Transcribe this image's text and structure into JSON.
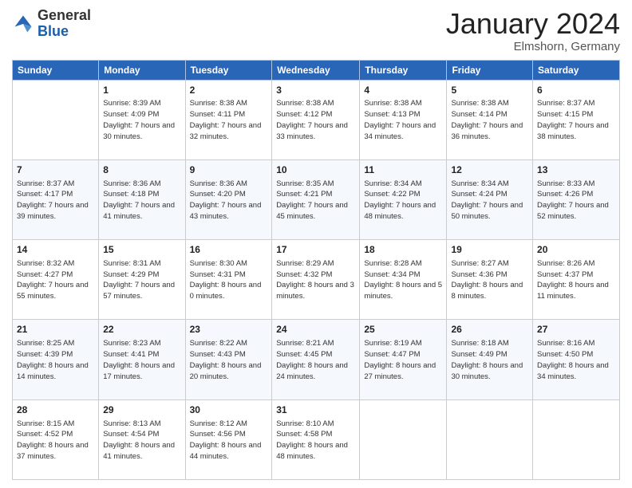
{
  "header": {
    "logo_general": "General",
    "logo_blue": "Blue",
    "month_title": "January 2024",
    "location": "Elmshorn, Germany"
  },
  "weekdays": [
    "Sunday",
    "Monday",
    "Tuesday",
    "Wednesday",
    "Thursday",
    "Friday",
    "Saturday"
  ],
  "weeks": [
    [
      {
        "day": "",
        "info": ""
      },
      {
        "day": "1",
        "info": "Sunrise: 8:39 AM\nSunset: 4:09 PM\nDaylight: 7 hours\nand 30 minutes."
      },
      {
        "day": "2",
        "info": "Sunrise: 8:38 AM\nSunset: 4:11 PM\nDaylight: 7 hours\nand 32 minutes."
      },
      {
        "day": "3",
        "info": "Sunrise: 8:38 AM\nSunset: 4:12 PM\nDaylight: 7 hours\nand 33 minutes."
      },
      {
        "day": "4",
        "info": "Sunrise: 8:38 AM\nSunset: 4:13 PM\nDaylight: 7 hours\nand 34 minutes."
      },
      {
        "day": "5",
        "info": "Sunrise: 8:38 AM\nSunset: 4:14 PM\nDaylight: 7 hours\nand 36 minutes."
      },
      {
        "day": "6",
        "info": "Sunrise: 8:37 AM\nSunset: 4:15 PM\nDaylight: 7 hours\nand 38 minutes."
      }
    ],
    [
      {
        "day": "7",
        "info": "Sunrise: 8:37 AM\nSunset: 4:17 PM\nDaylight: 7 hours\nand 39 minutes."
      },
      {
        "day": "8",
        "info": "Sunrise: 8:36 AM\nSunset: 4:18 PM\nDaylight: 7 hours\nand 41 minutes."
      },
      {
        "day": "9",
        "info": "Sunrise: 8:36 AM\nSunset: 4:20 PM\nDaylight: 7 hours\nand 43 minutes."
      },
      {
        "day": "10",
        "info": "Sunrise: 8:35 AM\nSunset: 4:21 PM\nDaylight: 7 hours\nand 45 minutes."
      },
      {
        "day": "11",
        "info": "Sunrise: 8:34 AM\nSunset: 4:22 PM\nDaylight: 7 hours\nand 48 minutes."
      },
      {
        "day": "12",
        "info": "Sunrise: 8:34 AM\nSunset: 4:24 PM\nDaylight: 7 hours\nand 50 minutes."
      },
      {
        "day": "13",
        "info": "Sunrise: 8:33 AM\nSunset: 4:26 PM\nDaylight: 7 hours\nand 52 minutes."
      }
    ],
    [
      {
        "day": "14",
        "info": "Sunrise: 8:32 AM\nSunset: 4:27 PM\nDaylight: 7 hours\nand 55 minutes."
      },
      {
        "day": "15",
        "info": "Sunrise: 8:31 AM\nSunset: 4:29 PM\nDaylight: 7 hours\nand 57 minutes."
      },
      {
        "day": "16",
        "info": "Sunrise: 8:30 AM\nSunset: 4:31 PM\nDaylight: 8 hours\nand 0 minutes."
      },
      {
        "day": "17",
        "info": "Sunrise: 8:29 AM\nSunset: 4:32 PM\nDaylight: 8 hours\nand 3 minutes."
      },
      {
        "day": "18",
        "info": "Sunrise: 8:28 AM\nSunset: 4:34 PM\nDaylight: 8 hours\nand 5 minutes."
      },
      {
        "day": "19",
        "info": "Sunrise: 8:27 AM\nSunset: 4:36 PM\nDaylight: 8 hours\nand 8 minutes."
      },
      {
        "day": "20",
        "info": "Sunrise: 8:26 AM\nSunset: 4:37 PM\nDaylight: 8 hours\nand 11 minutes."
      }
    ],
    [
      {
        "day": "21",
        "info": "Sunrise: 8:25 AM\nSunset: 4:39 PM\nDaylight: 8 hours\nand 14 minutes."
      },
      {
        "day": "22",
        "info": "Sunrise: 8:23 AM\nSunset: 4:41 PM\nDaylight: 8 hours\nand 17 minutes."
      },
      {
        "day": "23",
        "info": "Sunrise: 8:22 AM\nSunset: 4:43 PM\nDaylight: 8 hours\nand 20 minutes."
      },
      {
        "day": "24",
        "info": "Sunrise: 8:21 AM\nSunset: 4:45 PM\nDaylight: 8 hours\nand 24 minutes."
      },
      {
        "day": "25",
        "info": "Sunrise: 8:19 AM\nSunset: 4:47 PM\nDaylight: 8 hours\nand 27 minutes."
      },
      {
        "day": "26",
        "info": "Sunrise: 8:18 AM\nSunset: 4:49 PM\nDaylight: 8 hours\nand 30 minutes."
      },
      {
        "day": "27",
        "info": "Sunrise: 8:16 AM\nSunset: 4:50 PM\nDaylight: 8 hours\nand 34 minutes."
      }
    ],
    [
      {
        "day": "28",
        "info": "Sunrise: 8:15 AM\nSunset: 4:52 PM\nDaylight: 8 hours\nand 37 minutes."
      },
      {
        "day": "29",
        "info": "Sunrise: 8:13 AM\nSunset: 4:54 PM\nDaylight: 8 hours\nand 41 minutes."
      },
      {
        "day": "30",
        "info": "Sunrise: 8:12 AM\nSunset: 4:56 PM\nDaylight: 8 hours\nand 44 minutes."
      },
      {
        "day": "31",
        "info": "Sunrise: 8:10 AM\nSunset: 4:58 PM\nDaylight: 8 hours\nand 48 minutes."
      },
      {
        "day": "",
        "info": ""
      },
      {
        "day": "",
        "info": ""
      },
      {
        "day": "",
        "info": ""
      }
    ]
  ]
}
